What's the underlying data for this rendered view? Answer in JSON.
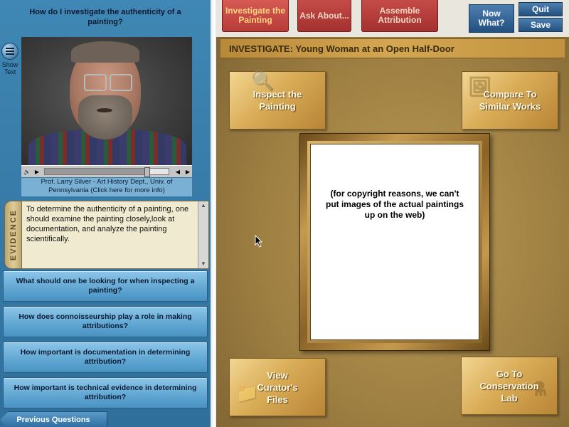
{
  "left_panel": {
    "question_title": "How do I investigate the authenticity of a painting?",
    "show_text_label": "Show Text",
    "video_caption": "Prof. Larry Silver - Art History Dept., Univ. of Pennsylvania (Click here for more info)",
    "evidence_tab_label": "EVIDENCE",
    "evidence_text": "To determine the authenticity of a painting, one should examine the painting closely,look at documentation, and analyze the painting scientifically.",
    "questions": [
      "What should one be looking for when inspecting a painting?",
      "How does connoisseurship play a role in making attributions?",
      "How important is documentation in determining attribution?",
      "How important is technical evidence in determining attribution?"
    ],
    "previous_questions_label": "Previous Questions"
  },
  "toolbar": {
    "tabs": [
      {
        "label": "Investigate the Painting"
      },
      {
        "label": "Ask About..."
      },
      {
        "label": "Assemble Attribution"
      }
    ],
    "now_what_label": "Now What?",
    "quit_label": "Quit",
    "save_label": "Save"
  },
  "main": {
    "title": "INVESTIGATE: Young Woman at an Open Half-Door",
    "tiles": {
      "inspect": "Inspect the Painting",
      "compare": "Compare To Similar Works",
      "curator": "View Curator's Files",
      "conservation": "Go To Conservation Lab"
    },
    "canvas_note": "(for copyright reasons, we can't put images of the actual paintings up on the web)"
  },
  "video_progress": 0.82,
  "colors": {
    "panel_blue": "#377aa7",
    "tab_red": "#a3312f",
    "gold": "#b99b57"
  }
}
